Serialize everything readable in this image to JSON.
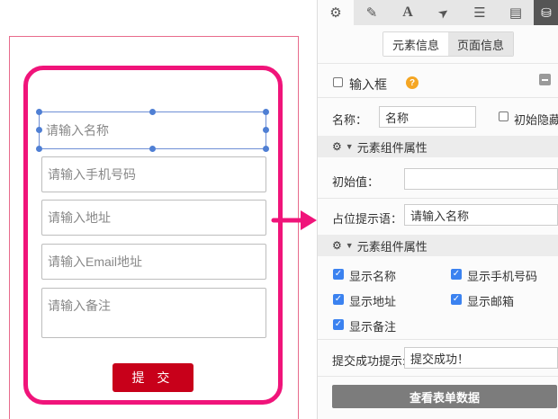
{
  "form": {
    "name_placeholder": "请输入名称",
    "phone_placeholder": "请输入手机号码",
    "address_placeholder": "请输入地址",
    "email_placeholder": "请输入Email地址",
    "remark_placeholder": "请输入备注",
    "submit_label": "提 交"
  },
  "panel": {
    "tabs": [
      {
        "icon": "gear-icon",
        "glyph": "⚙"
      },
      {
        "icon": "pencil-icon",
        "glyph": "✎"
      },
      {
        "icon": "font-icon",
        "glyph": "A"
      },
      {
        "icon": "send-icon",
        "glyph": "➤"
      },
      {
        "icon": "list-icon",
        "glyph": "☰"
      },
      {
        "icon": "document-icon",
        "glyph": "▤"
      },
      {
        "icon": "database-icon",
        "glyph": "⛁"
      }
    ],
    "seg_element_info": "元素信息",
    "seg_page_info": "页面信息",
    "element_type": "输入框",
    "help_glyph": "?",
    "name_label": "名称：",
    "name_value": "名称",
    "initial_hidden_label": "初始隐藏",
    "section1_title": "元素组件属性",
    "initial_value_label": "初始值：",
    "initial_value": "",
    "placeholder_label": "占位提示语：",
    "placeholder_value": "请输入名称",
    "section2_title": "元素组件属性",
    "show_name": "显示名称",
    "show_phone": "显示手机号码",
    "show_address": "显示地址",
    "show_email": "显示邮箱",
    "show_remark": "显示备注",
    "success_label": "提交成功提示:",
    "success_value": "提交成功！",
    "view_data_button": "查看表单数据"
  },
  "colors": {
    "frame": "#f0147a",
    "submit": "#c8001a",
    "checkbox": "#3b82f0",
    "help": "#f5a623"
  }
}
